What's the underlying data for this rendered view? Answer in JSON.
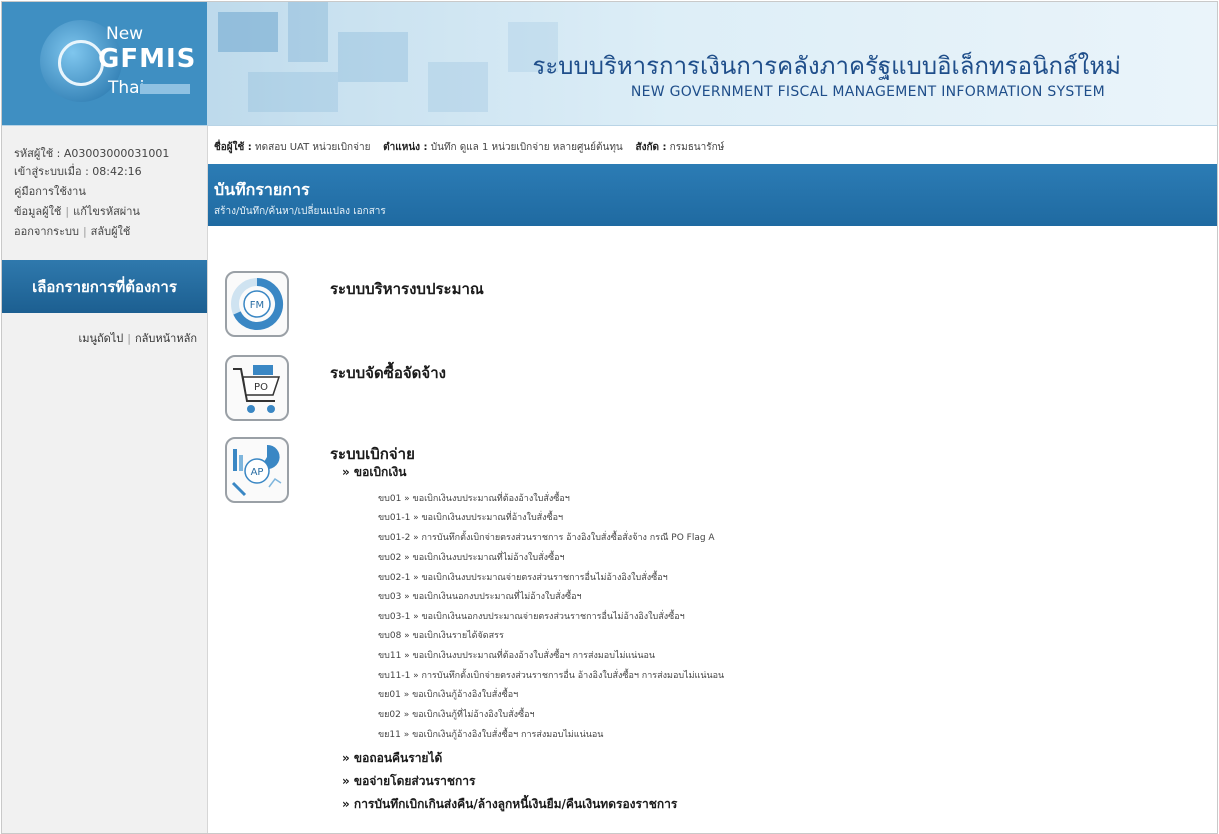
{
  "header": {
    "logo": {
      "new": "New",
      "gfmis": "GFMIS",
      "thai": "Thai"
    },
    "title_th": "ระบบบริหารการเงินการคลังภาครัฐแบบอิเล็กทรอนิกส์ใหม่",
    "title_en": "NEW GOVERNMENT FISCAL MANAGEMENT INFORMATION SYSTEM"
  },
  "sidebar": {
    "user_code": "รหัสผู้ใช้ : A03003000031001",
    "login_time": "เข้าสู่ระบบเมื่อ : 08:42:16",
    "manual": "คู่มือการใช้งาน",
    "user_info": "ข้อมูลผู้ใช้",
    "edit_password": "แก้ไขรหัสผ่าน",
    "logout": "ออกจากระบบ",
    "switch_user": "สลับผู้ใช้",
    "banner": "เลือกรายการที่ต้องการ",
    "next_menu": "เมนูถัดไป",
    "home": "กลับหน้าหลัก"
  },
  "userbar": {
    "name_label": "ชื่อผู้ใช้ :",
    "name_value": "ทดสอบ UAT หน่วยเบิกจ่าย",
    "position_label": "ตำแหน่ง :",
    "position_value": "บันทึก ดูแล 1 หน่วยเบิกจ่าย หลายศูนย์ต้นทุน",
    "org_label": "สังกัด :",
    "org_value": "กรมธนารักษ์"
  },
  "page": {
    "title": "บันทึกรายการ",
    "subtitle": "สร้าง/บันทึก/ค้นหา/เปลี่ยนแปลง เอกสาร"
  },
  "systems": {
    "fm": {
      "icon_label": "FM",
      "title": "ระบบบริหารงบประมาณ"
    },
    "po": {
      "icon_label": "PO",
      "title": "ระบบจัดซื้อจัดจ้าง"
    },
    "ap": {
      "icon_label": "AP",
      "title": "ระบบเบิกจ่าย",
      "section1": "» ขอเบิกเงิน",
      "items": [
        "ขบ01 » ขอเบิกเงินงบประมาณที่ต้องอ้างใบสั่งซื้อฯ",
        "ขบ01-1 » ขอเบิกเงินงบประมาณที่อ้างใบสั่งซื้อฯ",
        "ขบ01-2 » การบันทึกตั้งเบิกจ่ายตรงส่วนราชการ อ้างอิงใบสั่งซื้อสั่งจ้าง กรณี PO Flag A",
        "ขบ02 » ขอเบิกเงินงบประมาณที่ไม่อ้างใบสั่งซื้อฯ",
        "ขบ02-1 » ขอเบิกเงินงบประมาณจ่ายตรงส่วนราชการอื่นไม่อ้างอิงใบสั่งซื้อฯ",
        "ขบ03 » ขอเบิกเงินนอกงบประมาณที่ไม่อ้างใบสั่งซื้อฯ",
        "ขบ03-1 » ขอเบิกเงินนอกงบประมาณจ่ายตรงส่วนราชการอื่นไม่อ้างอิงใบสั่งซื้อฯ",
        "ขบ08 » ขอเบิกเงินรายได้จัดสรร",
        "ขบ11 » ขอเบิกเงินงบประมาณที่ต้องอ้างใบสั่งซื้อฯ การส่งมอบไม่แน่นอน",
        "ขบ11-1 » การบันทึกตั้งเบิกจ่ายตรงส่วนราชการอื่น อ้างอิงใบสั่งซื้อฯ การส่งมอบไม่แน่นอน",
        "ขย01 » ขอเบิกเงินกู้อ้างอิงใบสั่งซื้อฯ",
        "ขย02 » ขอเบิกเงินกู้ที่ไม่อ้างอิงใบสั่งซื้อฯ",
        "ขย11 » ขอเบิกเงินกู้อ้างอิงใบสั่งซื้อฯ การส่งมอบไม่แน่นอน"
      ],
      "section2": "» ขอถอนคืนรายได้",
      "section3": "» ขอจ่ายโดยส่วนราชการ",
      "section4": "» การบันทึกเบิกเกินส่งคืน/ล้างลูกหนี้เงินยืม/คืนเงินทดรองราชการ"
    }
  },
  "colors": {
    "brand_blue": "#1f6aa1",
    "title_blue": "#1f4e8a"
  }
}
